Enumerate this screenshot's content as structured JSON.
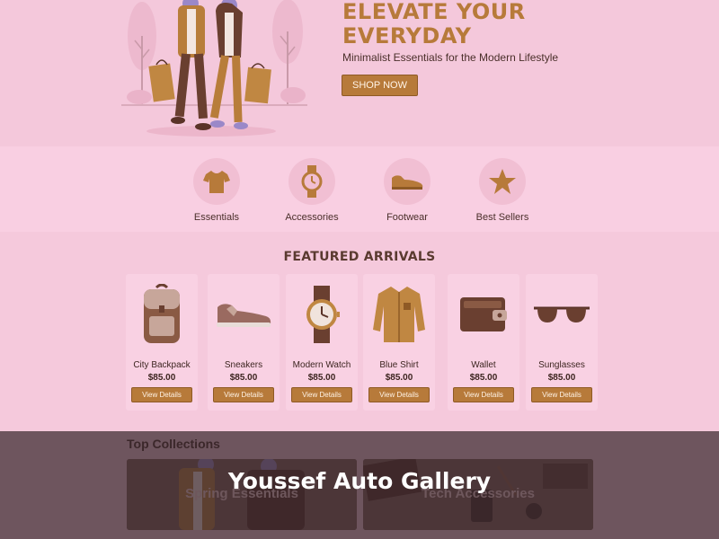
{
  "hero": {
    "title_line1": "ELEVATE YOUR",
    "title_line2": "EVERYDAY",
    "subtitle": "Minimalist Essentials for the Modern Lifestyle",
    "cta_label": "SHOP NOW"
  },
  "categories": [
    {
      "label": "Essentials",
      "icon": "tshirt-icon"
    },
    {
      "label": "Accessories",
      "icon": "watch-icon"
    },
    {
      "label": "Footwear",
      "icon": "shoe-icon"
    },
    {
      "label": "Best Sellers",
      "icon": "star-icon"
    }
  ],
  "featured": {
    "title": "FEATURED ARRIVALS",
    "products": [
      {
        "name": "City Backpack",
        "price": "$85.00",
        "button": "View Details",
        "icon": "backpack-icon"
      },
      {
        "name": "Sneakers",
        "price": "$85.00",
        "button": "View Details",
        "icon": "sneaker-icon"
      },
      {
        "name": "Modern Watch",
        "price": "$85.00",
        "button": "View Details",
        "icon": "watch-icon"
      },
      {
        "name": "Blue Shirt",
        "price": "$85.00",
        "button": "View Details",
        "icon": "shirt-icon"
      },
      {
        "name": "Wallet",
        "price": "$85.00",
        "button": "View Details",
        "icon": "wallet-icon"
      },
      {
        "name": "Sunglasses",
        "price": "$85.00",
        "button": "View Details",
        "icon": "sunglasses-icon"
      }
    ]
  },
  "collections": {
    "title": "Top Collections",
    "items": [
      {
        "label": "Spring Essentials"
      },
      {
        "label": "Tech Accessories"
      }
    ]
  },
  "overlay": {
    "title": "Youssef Auto Gallery"
  },
  "colors": {
    "accent": "#b77a3a",
    "background": "#f5c9dc",
    "overlay": "#3a282e"
  }
}
